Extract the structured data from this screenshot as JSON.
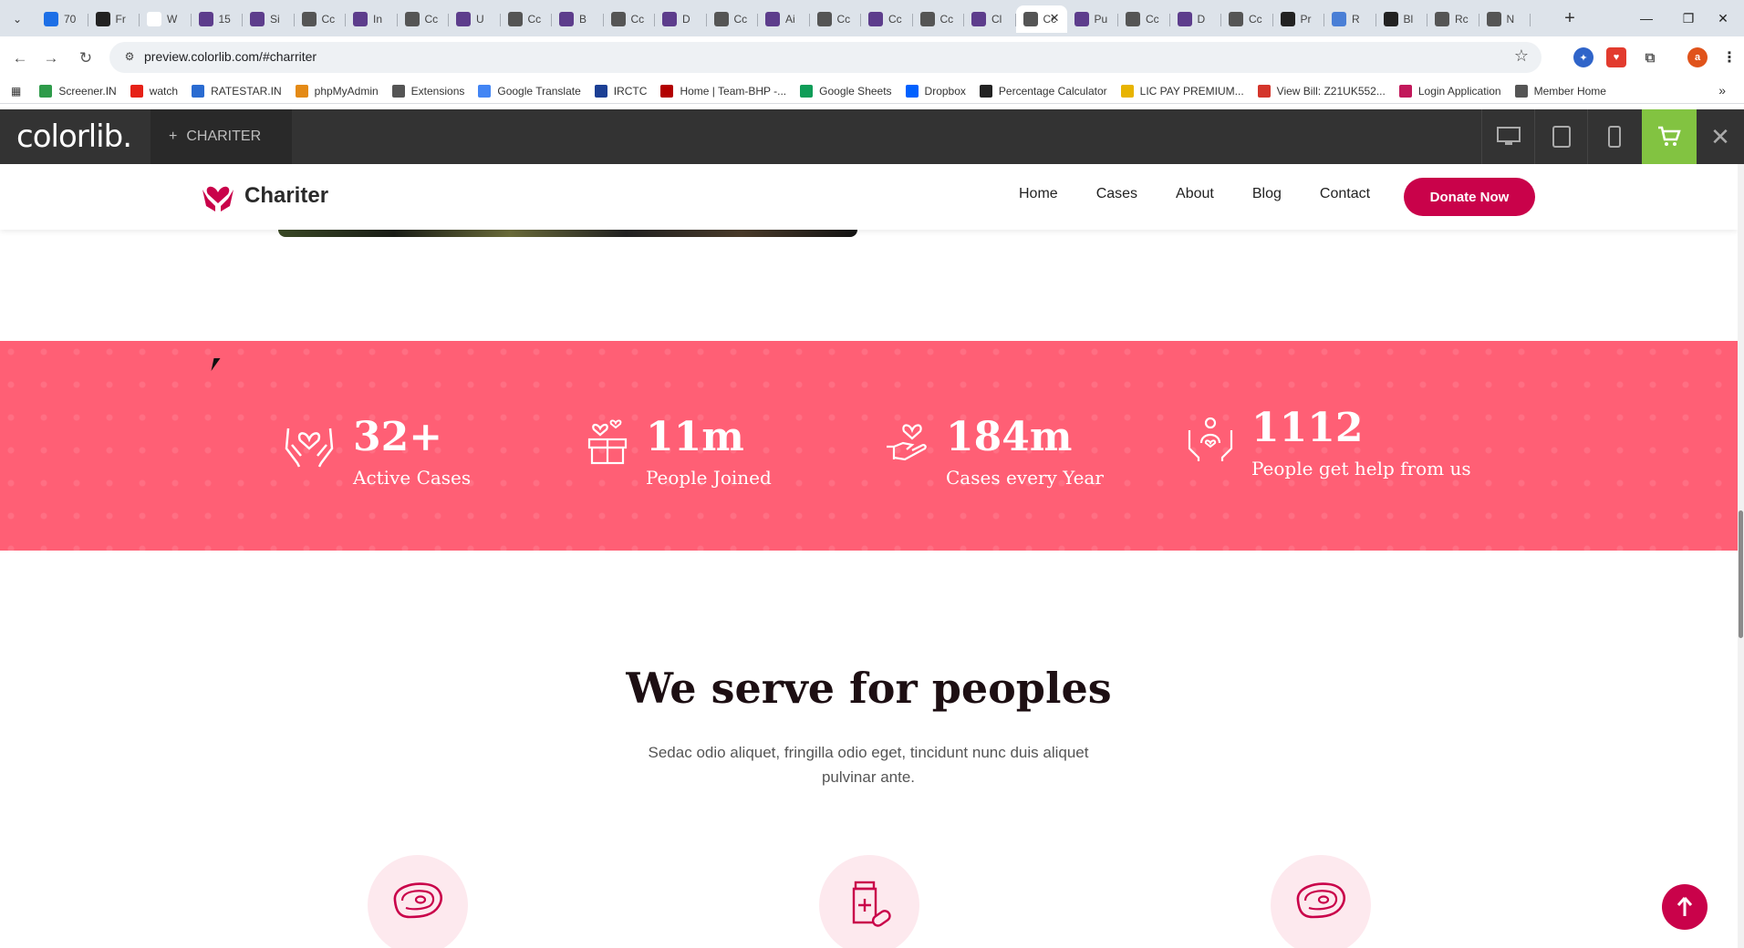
{
  "browser": {
    "tabs": [
      {
        "title": "70",
        "favicon_color": "#1d6fe6"
      },
      {
        "title": "Fr",
        "favicon_color": "#222222"
      },
      {
        "title": "W",
        "favicon_color": "#ffffff"
      },
      {
        "title": "15",
        "favicon_color": "#5d3d8c"
      },
      {
        "title": "Si",
        "favicon_color": "#5d3d8c"
      },
      {
        "title": "Cc",
        "favicon_color": "#555555"
      },
      {
        "title": "In",
        "favicon_color": "#5d3d8c"
      },
      {
        "title": "Cc",
        "favicon_color": "#555555"
      },
      {
        "title": "U",
        "favicon_color": "#5d3d8c"
      },
      {
        "title": "Cc",
        "favicon_color": "#555555"
      },
      {
        "title": "B",
        "favicon_color": "#5d3d8c"
      },
      {
        "title": "Cc",
        "favicon_color": "#555555"
      },
      {
        "title": "D",
        "favicon_color": "#5d3d8c"
      },
      {
        "title": "Cc",
        "favicon_color": "#555555"
      },
      {
        "title": "Ai",
        "favicon_color": "#5d3d8c"
      },
      {
        "title": "Cc",
        "favicon_color": "#555555"
      },
      {
        "title": "Cc",
        "favicon_color": "#5d3d8c"
      },
      {
        "title": "Cc",
        "favicon_color": "#555555"
      },
      {
        "title": "Cl",
        "favicon_color": "#5d3d8c"
      },
      {
        "title": "Cc",
        "favicon_color": "#555555",
        "active": true
      },
      {
        "title": "Pu",
        "favicon_color": "#5d3d8c"
      },
      {
        "title": "Cc",
        "favicon_color": "#555555"
      },
      {
        "title": "D",
        "favicon_color": "#5d3d8c"
      },
      {
        "title": "Cc",
        "favicon_color": "#555555"
      },
      {
        "title": "Pr",
        "favicon_color": "#222222"
      },
      {
        "title": "R",
        "favicon_color": "#4a7fd6"
      },
      {
        "title": "Bl",
        "favicon_color": "#222222"
      },
      {
        "title": "Rc",
        "favicon_color": "#555555"
      },
      {
        "title": "N",
        "favicon_color": "#555555"
      }
    ],
    "url": "preview.colorlib.com/#charriter",
    "profile_initial": "a",
    "bookmarks": [
      {
        "label": "Screener.IN",
        "color": "#2e9b4a"
      },
      {
        "label": "watch",
        "color": "#e62117"
      },
      {
        "label": "RATESTAR.IN",
        "color": "#2a6bd1"
      },
      {
        "label": "phpMyAdmin",
        "color": "#e48a16"
      },
      {
        "label": "Extensions",
        "color": "#555555"
      },
      {
        "label": "Google Translate",
        "color": "#4285f4"
      },
      {
        "label": "IRCTC",
        "color": "#1c3f94"
      },
      {
        "label": "Home | Team-BHP -...",
        "color": "#b30000"
      },
      {
        "label": "Google Sheets",
        "color": "#0f9d58"
      },
      {
        "label": "Dropbox",
        "color": "#0061fe"
      },
      {
        "label": "Percentage Calculator",
        "color": "#222222"
      },
      {
        "label": "LIC PAY PREMIUM...",
        "color": "#e8b400"
      },
      {
        "label": "View Bill: Z21UK552...",
        "color": "#d4352b"
      },
      {
        "label": "Login Application",
        "color": "#c2185b"
      },
      {
        "label": "Member Home",
        "color": "#555555"
      }
    ]
  },
  "colorlib_bar": {
    "logo": "colorlib.",
    "theme_label": "CHARITER",
    "theme_prefix": "+"
  },
  "site": {
    "brand": "Chariter",
    "nav": [
      "Home",
      "Cases",
      "About",
      "Blog",
      "Contact"
    ],
    "donate_label": "Donate Now",
    "accent_color": "#c9024a",
    "stats_bg": "#ff5f75",
    "stats": [
      {
        "number": "32+",
        "label": "Active Cases",
        "icon": "hands-heart-icon"
      },
      {
        "number": "11m",
        "label": "People Joined",
        "icon": "gift-box-heart-icon"
      },
      {
        "number": "184m",
        "label": "Cases every Year",
        "icon": "hand-heart-icon"
      },
      {
        "number": "1112",
        "label": "People get help from us",
        "icon": "people-help-icon"
      }
    ],
    "serve_title": "We serve for peoples",
    "serve_subtitle": "Sedac odio aliquet, fringilla odio eget, tincidunt nunc duis aliquet pulvinar ante.",
    "serve_icons": [
      "meat-icon",
      "medicine-icon",
      "meat-icon"
    ]
  }
}
